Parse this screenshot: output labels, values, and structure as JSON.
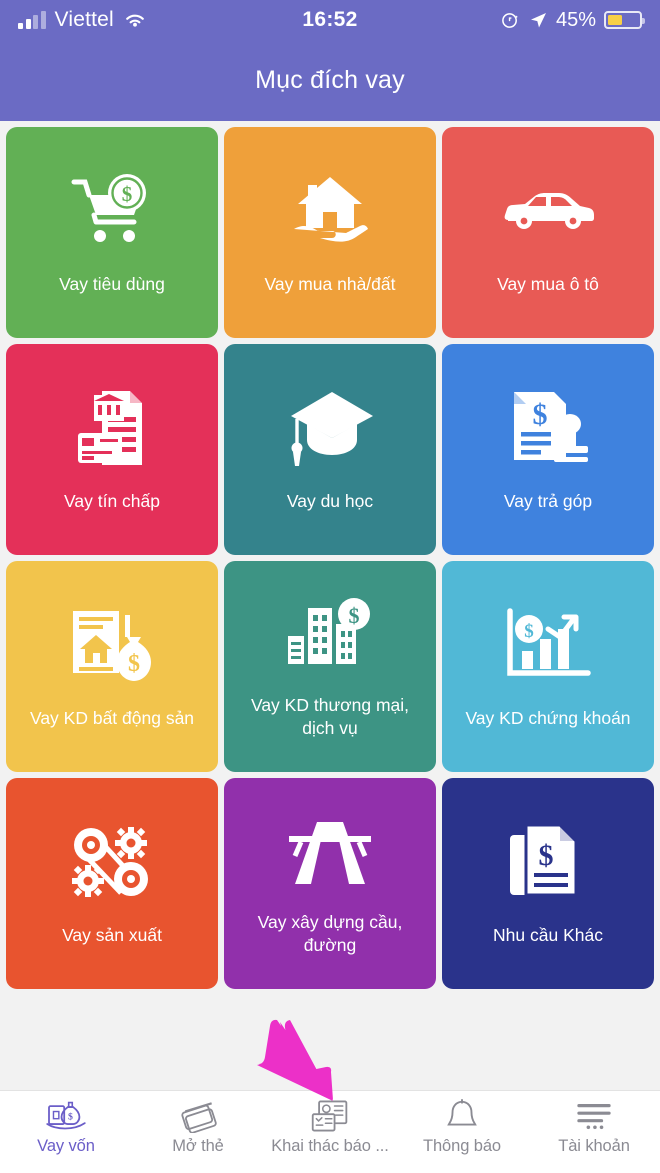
{
  "status_bar": {
    "carrier": "Viettel",
    "time": "16:52",
    "battery_percent": "45%",
    "icons": [
      "signal-bars-icon",
      "wifi-icon",
      "rotation-lock-icon",
      "location-arrow-icon",
      "battery-icon"
    ]
  },
  "header": {
    "title": "Mục đích vay"
  },
  "grid": {
    "tiles": [
      {
        "label": "Vay tiêu dùng",
        "color": "#62b055",
        "icon": "shopping-cart-money-icon",
        "two_line": false
      },
      {
        "label": "Vay mua nhà/đất",
        "color": "#efa03a",
        "icon": "house-in-hand-icon",
        "two_line": false
      },
      {
        "label": "Vay mua ô tô",
        "color": "#e85a55",
        "icon": "car-icon",
        "two_line": false
      },
      {
        "label": "Vay tín chấp",
        "color": "#e43059",
        "icon": "documents-card-icon",
        "two_line": false
      },
      {
        "label": "Vay du học",
        "color": "#34838c",
        "icon": "graduation-cap-icon",
        "two_line": false
      },
      {
        "label": "Vay trả góp",
        "color": "#3f82de",
        "icon": "invoice-stamp-icon",
        "two_line": false
      },
      {
        "label": "Vay KD bất động sản",
        "color": "#f2c44c",
        "icon": "property-money-bag-icon",
        "two_line": false
      },
      {
        "label": "Vay KD thương mại, dịch vụ",
        "color": "#3d9484",
        "icon": "buildings-money-icon",
        "two_line": true
      },
      {
        "label": "Vay KD chứng khoán",
        "color": "#51b8d6",
        "icon": "stock-chart-money-icon",
        "two_line": false
      },
      {
        "label": "Vay sản xuất",
        "color": "#e8542f",
        "icon": "gears-belt-icon",
        "two_line": false
      },
      {
        "label": "Vay xây dựng cầu, đường",
        "color": "#9130ab",
        "icon": "highway-road-icon",
        "two_line": true
      },
      {
        "label": "Nhu cầu Khác",
        "color": "#2a338b",
        "icon": "documents-dollar-icon",
        "two_line": false
      }
    ]
  },
  "annotation": {
    "arrow_color": "#ec30c8",
    "arrow_name": "pink-pointer-arrow",
    "points_to": "Khai thác báo ..."
  },
  "bottom_nav": {
    "active_color": "#6b5ec8",
    "inactive_color": "#8b8b93",
    "items": [
      {
        "label": "Vay vốn",
        "icon": "loan-money-icon",
        "active": true
      },
      {
        "label": "Mở thẻ",
        "icon": "credit-cards-icon",
        "active": false
      },
      {
        "label": "Khai thác báo ...",
        "icon": "report-page-icon",
        "active": false
      },
      {
        "label": "Thông báo",
        "icon": "bell-icon",
        "active": false
      },
      {
        "label": "Tài khoản",
        "icon": "menu-lines-icon",
        "active": false
      }
    ]
  }
}
